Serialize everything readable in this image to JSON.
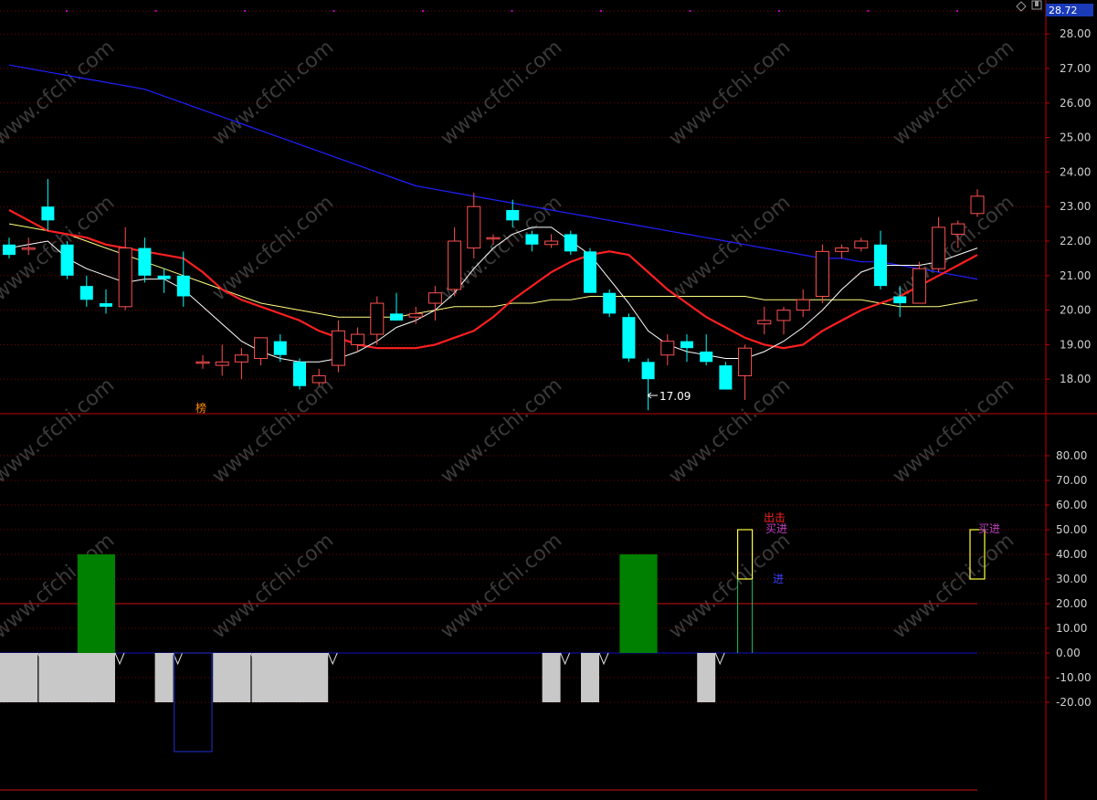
{
  "price_box": "28.72",
  "low_label": "17.09",
  "badge": "榜",
  "signals": {
    "chuji": "出击",
    "mairu": "买进",
    "jin": "进"
  },
  "watermark": "www.cfchi.com",
  "colors": {
    "bg": "#000000",
    "grid": "#7a0000",
    "axis": "#c00000",
    "tick": "#cfcfcf",
    "up": "#ff5050",
    "down": "#00ffff",
    "ma5": "#ffffff",
    "ma10": "#ff1f1f",
    "ma20": "#ffff80",
    "ma60": "#2020ff",
    "green_bar": "#008000",
    "gray_bar": "#c8c8c8"
  },
  "chart_data": [
    {
      "type": "candlestick",
      "ylim": [
        17.0,
        28.72
      ],
      "ticks": [
        "18.00",
        "19.00",
        "20.00",
        "21.00",
        "22.00",
        "23.00",
        "24.00",
        "25.00",
        "26.00",
        "27.00",
        "28.00"
      ],
      "candles": [
        {
          "o": 21.9,
          "h": 22.1,
          "l": 21.5,
          "c": 21.6
        },
        {
          "o": 21.8,
          "h": 22.1,
          "l": 21.6,
          "c": 21.8
        },
        {
          "o": 23.0,
          "h": 23.8,
          "l": 22.3,
          "c": 22.6
        },
        {
          "o": 21.9,
          "h": 22.0,
          "l": 20.9,
          "c": 21.0
        },
        {
          "o": 20.7,
          "h": 21.0,
          "l": 20.1,
          "c": 20.3
        },
        {
          "o": 20.2,
          "h": 20.6,
          "l": 19.9,
          "c": 20.1
        },
        {
          "o": 20.1,
          "h": 22.4,
          "l": 20.0,
          "c": 21.8
        },
        {
          "o": 21.8,
          "h": 22.1,
          "l": 20.8,
          "c": 21.0
        },
        {
          "o": 21.0,
          "h": 21.2,
          "l": 20.5,
          "c": 20.9
        },
        {
          "o": 21.0,
          "h": 21.7,
          "l": 20.1,
          "c": 20.4
        },
        {
          "o": 18.5,
          "h": 18.7,
          "l": 18.3,
          "c": 18.5
        },
        {
          "o": 18.4,
          "h": 19.0,
          "l": 18.1,
          "c": 18.5
        },
        {
          "o": 18.5,
          "h": 18.9,
          "l": 18.0,
          "c": 18.7
        },
        {
          "o": 18.6,
          "h": 19.2,
          "l": 18.4,
          "c": 19.2
        },
        {
          "o": 19.1,
          "h": 19.3,
          "l": 18.5,
          "c": 18.7
        },
        {
          "o": 18.5,
          "h": 18.6,
          "l": 17.7,
          "c": 17.8
        },
        {
          "o": 17.9,
          "h": 18.3,
          "l": 17.8,
          "c": 18.1
        },
        {
          "o": 18.4,
          "h": 19.7,
          "l": 18.2,
          "c": 19.4
        },
        {
          "o": 19.0,
          "h": 19.5,
          "l": 18.8,
          "c": 19.3
        },
        {
          "o": 19.3,
          "h": 20.4,
          "l": 19.0,
          "c": 20.2
        },
        {
          "o": 19.9,
          "h": 20.5,
          "l": 19.7,
          "c": 19.7
        },
        {
          "o": 19.8,
          "h": 20.1,
          "l": 19.6,
          "c": 19.9
        },
        {
          "o": 20.2,
          "h": 20.7,
          "l": 19.7,
          "c": 20.5
        },
        {
          "o": 20.6,
          "h": 22.4,
          "l": 20.4,
          "c": 22.0
        },
        {
          "o": 21.8,
          "h": 23.4,
          "l": 21.5,
          "c": 23.0
        },
        {
          "o": 22.1,
          "h": 22.2,
          "l": 21.9,
          "c": 22.1
        },
        {
          "o": 22.9,
          "h": 23.2,
          "l": 22.4,
          "c": 22.6
        },
        {
          "o": 22.2,
          "h": 22.3,
          "l": 21.7,
          "c": 21.9
        },
        {
          "o": 21.9,
          "h": 22.2,
          "l": 21.8,
          "c": 22.0
        },
        {
          "o": 22.2,
          "h": 22.3,
          "l": 21.6,
          "c": 21.7
        },
        {
          "o": 21.7,
          "h": 21.8,
          "l": 20.5,
          "c": 20.5
        },
        {
          "o": 20.5,
          "h": 20.6,
          "l": 19.8,
          "c": 19.9
        },
        {
          "o": 19.8,
          "h": 19.9,
          "l": 18.5,
          "c": 18.6
        },
        {
          "o": 18.5,
          "h": 18.6,
          "l": 17.1,
          "c": 18.0
        },
        {
          "o": 18.7,
          "h": 19.3,
          "l": 18.4,
          "c": 19.1
        },
        {
          "o": 19.1,
          "h": 19.3,
          "l": 18.5,
          "c": 18.9
        },
        {
          "o": 18.8,
          "h": 19.3,
          "l": 18.4,
          "c": 18.5
        },
        {
          "o": 18.4,
          "h": 18.5,
          "l": 17.7,
          "c": 17.7
        },
        {
          "o": 18.1,
          "h": 19.0,
          "l": 17.4,
          "c": 18.9
        },
        {
          "o": 19.6,
          "h": 20.1,
          "l": 19.3,
          "c": 19.7
        },
        {
          "o": 19.7,
          "h": 20.1,
          "l": 19.3,
          "c": 20.0
        },
        {
          "o": 20.0,
          "h": 20.6,
          "l": 19.8,
          "c": 20.3
        },
        {
          "o": 20.4,
          "h": 21.9,
          "l": 20.2,
          "c": 21.7
        },
        {
          "o": 21.7,
          "h": 21.9,
          "l": 21.5,
          "c": 21.8
        },
        {
          "o": 21.8,
          "h": 22.1,
          "l": 21.7,
          "c": 22.0
        },
        {
          "o": 21.9,
          "h": 22.3,
          "l": 20.6,
          "c": 20.7
        },
        {
          "o": 20.4,
          "h": 20.7,
          "l": 19.8,
          "c": 20.2
        },
        {
          "o": 20.2,
          "h": 21.4,
          "l": 20.2,
          "c": 21.2
        },
        {
          "o": 21.2,
          "h": 22.7,
          "l": 21.1,
          "c": 22.4
        },
        {
          "o": 22.2,
          "h": 22.6,
          "l": 21.8,
          "c": 22.5
        },
        {
          "o": 22.8,
          "h": 23.5,
          "l": 22.7,
          "c": 23.3
        }
      ],
      "ma5": [
        21.8,
        21.9,
        22.0,
        21.5,
        21.2,
        21.0,
        20.8,
        20.9,
        20.9,
        20.6,
        20.1,
        19.6,
        19.1,
        18.8,
        18.6,
        18.5,
        18.5,
        18.6,
        18.8,
        19.1,
        19.5,
        19.7,
        20.0,
        20.5,
        21.2,
        21.8,
        22.2,
        22.4,
        22.4,
        22.0,
        21.6,
        20.9,
        20.2,
        19.4,
        19.0,
        18.8,
        18.7,
        18.6,
        18.6,
        18.8,
        19.1,
        19.5,
        20.0,
        20.6,
        21.1,
        21.3,
        21.3,
        21.3,
        21.4,
        21.6,
        21.8
      ],
      "ma10": [
        22.9,
        22.6,
        22.3,
        22.2,
        22.1,
        21.9,
        21.8,
        21.7,
        21.6,
        21.5,
        21.1,
        20.6,
        20.3,
        20.1,
        19.9,
        19.7,
        19.4,
        19.2,
        19.0,
        18.9,
        18.9,
        18.9,
        19.0,
        19.2,
        19.4,
        19.8,
        20.3,
        20.7,
        21.1,
        21.4,
        21.6,
        21.7,
        21.6,
        21.1,
        20.6,
        20.2,
        19.8,
        19.5,
        19.2,
        19.0,
        18.9,
        19.0,
        19.4,
        19.7,
        20.0,
        20.2,
        20.4,
        20.7,
        21.0,
        21.3,
        21.6
      ],
      "ma20": [
        22.5,
        22.4,
        22.3,
        22.2,
        22.0,
        21.8,
        21.6,
        21.4,
        21.2,
        21.0,
        20.8,
        20.6,
        20.4,
        20.2,
        20.1,
        20.0,
        19.9,
        19.8,
        19.8,
        19.8,
        19.8,
        19.9,
        20.0,
        20.1,
        20.1,
        20.1,
        20.2,
        20.2,
        20.3,
        20.3,
        20.4,
        20.4,
        20.4,
        20.4,
        20.4,
        20.4,
        20.4,
        20.4,
        20.4,
        20.3,
        20.3,
        20.3,
        20.3,
        20.3,
        20.3,
        20.2,
        20.1,
        20.1,
        20.1,
        20.2,
        20.3
      ],
      "ma60": [
        27.1,
        27.0,
        26.9,
        26.8,
        26.7,
        26.6,
        26.5,
        26.4,
        26.2,
        26.0,
        25.8,
        25.6,
        25.4,
        25.2,
        25.0,
        24.8,
        24.6,
        24.4,
        24.2,
        24.0,
        23.8,
        23.6,
        23.5,
        23.4,
        23.3,
        23.2,
        23.1,
        23.0,
        22.9,
        22.8,
        22.7,
        22.6,
        22.5,
        22.4,
        22.3,
        22.2,
        22.1,
        22.0,
        21.9,
        21.8,
        21.7,
        21.6,
        21.5,
        21.5,
        21.4,
        21.4,
        21.3,
        21.2,
        21.1,
        21.0,
        20.9
      ]
    },
    {
      "type": "bar",
      "ylim": [
        -40,
        95
      ],
      "ticks": [
        "-20.00",
        "-10.00",
        "0.00",
        "10.00",
        "20.00",
        "30.00",
        "40.00",
        "50.00",
        "60.00",
        "70.00",
        "80.00"
      ],
      "green_bars": [
        {
          "from": 4,
          "to": 5,
          "value": 40
        },
        {
          "from": 32,
          "to": 33,
          "value": 40
        }
      ],
      "gray_bars": [
        {
          "from": 0,
          "to": 1,
          "value": -20
        },
        {
          "from": 2,
          "to": 5,
          "value": -20
        },
        {
          "from": 8,
          "to": 8,
          "value": -20
        },
        {
          "from": 11,
          "to": 12,
          "value": -20
        },
        {
          "from": 13,
          "to": 16,
          "value": -20
        },
        {
          "from": 28,
          "to": 28,
          "value": -20
        },
        {
          "from": 30,
          "to": 30,
          "value": -20
        },
        {
          "from": 36,
          "to": 36,
          "value": -20
        }
      ],
      "neg_boxes": [
        {
          "from": 9,
          "to": 10,
          "value": -40
        }
      ],
      "signal_boxes": [
        {
          "i": 38,
          "low": 30,
          "high": 50
        },
        {
          "i": 50,
          "low": 30,
          "high": 50
        }
      ],
      "reference_line": 20
    }
  ]
}
